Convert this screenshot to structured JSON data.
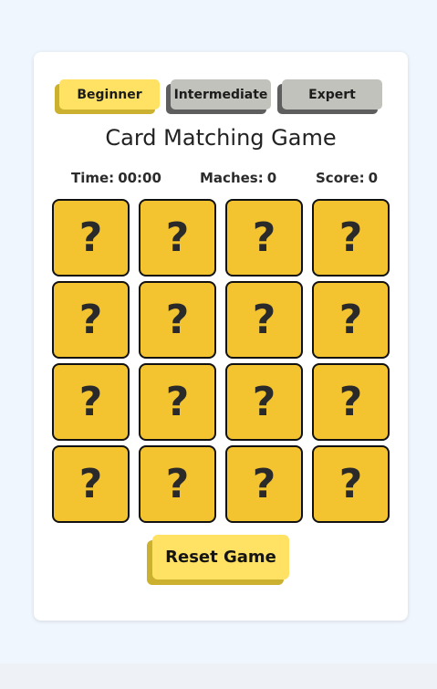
{
  "levels": [
    {
      "label": "Beginner",
      "active": true
    },
    {
      "label": "Intermediate",
      "active": false
    },
    {
      "label": "Expert",
      "active": false
    }
  ],
  "title": "Card Matching Game",
  "stats": {
    "time_label": "Time:",
    "time_value": "00:00",
    "matches_label": "Maches:",
    "matches_value": "0",
    "score_label": "Score:",
    "score_value": "0"
  },
  "cards": [
    "?",
    "?",
    "?",
    "?",
    "?",
    "?",
    "?",
    "?",
    "?",
    "?",
    "?",
    "?",
    "?",
    "?",
    "?",
    "?"
  ],
  "reset_label": "Reset Game",
  "colors": {
    "background": "#f0f6fd",
    "panel": "#ffffff",
    "active_button": "#ffe264",
    "active_button_shadow": "#ccb02f",
    "inactive_button": "#c2c2bd",
    "inactive_button_shadow": "#5e5e5e",
    "card": "#f4c430",
    "card_border": "#111111"
  }
}
